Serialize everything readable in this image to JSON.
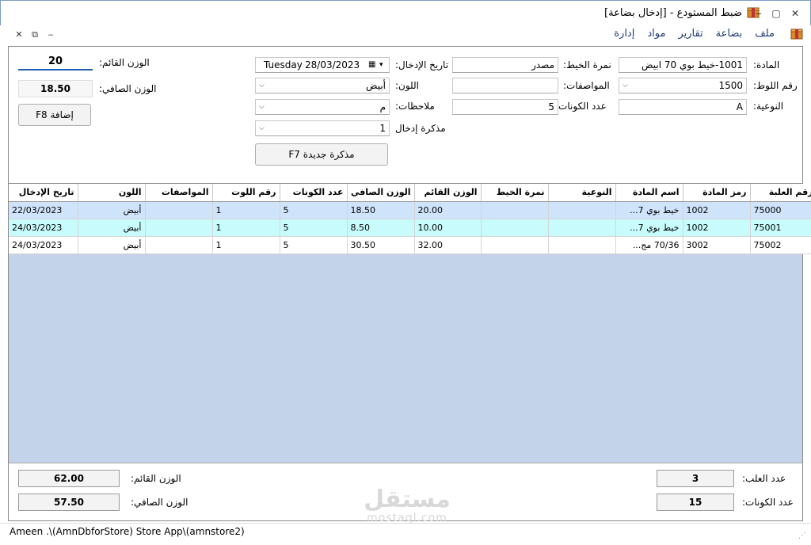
{
  "window": {
    "title": "ضبط المستودع - [إدخال بضاعة]",
    "icon": "package-icon",
    "controls": [
      "minimize",
      "maximize",
      "close"
    ]
  },
  "menu": {
    "items": [
      "ملف",
      "بضاعة",
      "تقارير",
      "مواد",
      "إدارة"
    ],
    "icon": "package-icon"
  },
  "form": {
    "material_label": "المادة:",
    "material_value": "1001-خيط بوي 70 ابيض",
    "lot_label": "رقم اللوط:",
    "lot_value": "1500",
    "type_label": "النوعية:",
    "type_value": "A",
    "thread_no_label": "نمرة الخيط:",
    "thread_no_value": "مصدر",
    "specs_label": "المواصفات:",
    "specs_value": "",
    "cones_label": "عدد الكونات:",
    "cones_value": "5",
    "entry_date_label": "تاريخ الإدخال:",
    "entry_date_day": "Tuesday",
    "entry_date_value": "28/03/2023",
    "color_label": "اللون:",
    "color_value": "أبيض",
    "notes_label": "ملاحظات:",
    "notes_value": "م",
    "memo_label": "مذكرة إدخال",
    "memo_value": "1",
    "new_memo_button": "مذكرة جديدة F7",
    "gross_weight_label": "الوزن القائم:",
    "gross_weight_value": "20",
    "net_weight_label": "الوزن الصافي:",
    "net_weight_value": "18.50",
    "add_button": "إضافة F8"
  },
  "grid": {
    "columns": [
      "رقم العلبة",
      "رمز المادة",
      "اسم المادة",
      "النوعية",
      "نمرة الخيط",
      "الوزن القائم",
      "الوزن الصافي",
      "عدد الكونات",
      "رقم اللوت",
      "المواصفات",
      "اللون",
      "تاريخ الإدخال"
    ],
    "rows": [
      [
        "75000",
        "1002",
        "خيط بوي 7...",
        "",
        "",
        "20.00",
        "18.50",
        "5",
        "1",
        "",
        "أبيض",
        "22/03/2023"
      ],
      [
        "75001",
        "1002",
        "خيط بوي 7...",
        "",
        "",
        "10.00",
        "8.50",
        "5",
        "1",
        "",
        "أبيض",
        "24/03/2023"
      ],
      [
        "75002",
        "3002",
        "70/36 مج...",
        "",
        "",
        "32.00",
        "30.50",
        "5",
        "1",
        "",
        "أبيض",
        "24/03/2023"
      ]
    ]
  },
  "totals": {
    "boxes_label": "عدد العلب:",
    "boxes_value": "3",
    "cones_label": "عدد الكونات:",
    "cones_value": "15",
    "gross_label": "الوزن القائم:",
    "gross_value": "62.00",
    "net_label": "الوزن الصافي:",
    "net_value": "57.50"
  },
  "watermark": {
    "arabic": "مستقل",
    "latin": "mostaql.com"
  },
  "status": {
    "text": "Ameen .\\(AmnDbforStore) Store App\\(amnstore2)"
  }
}
